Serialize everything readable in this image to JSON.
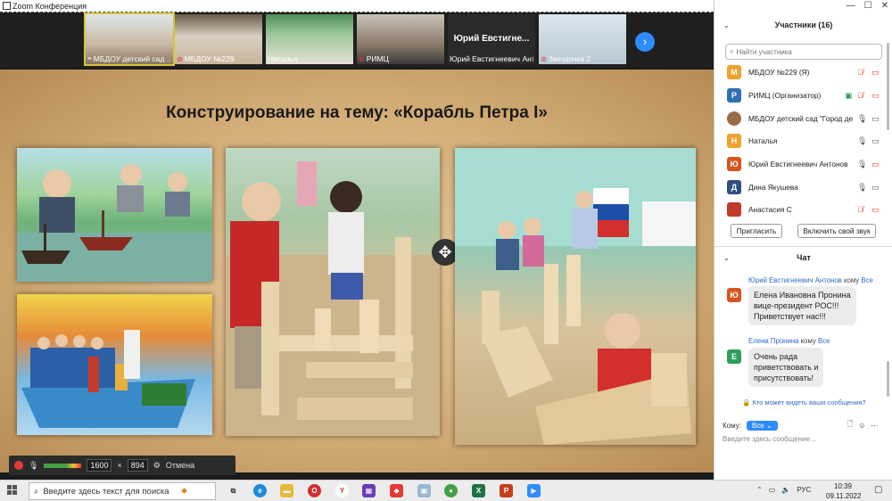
{
  "window": {
    "title": "Zoom Конференция"
  },
  "video_strip": {
    "tiles": [
      {
        "caption": "МБДОУ детский сад ...",
        "muted": false,
        "active": true
      },
      {
        "caption": "МБДОУ №229",
        "muted": true
      },
      {
        "caption": "Наталья",
        "muted": false
      },
      {
        "caption": "РИМЦ",
        "muted": true
      },
      {
        "caption": "Юрий Евстигнеевич Ант...",
        "muted": false,
        "big_name": "Юрий Евстигне..."
      },
      {
        "caption": "Звездочка 2",
        "muted": true
      }
    ]
  },
  "slide": {
    "title": "Конструирование на тему: «Корабль Петра I»"
  },
  "recording_toolbar": {
    "width": "1600",
    "sep": "×",
    "height": "894",
    "cancel_label": "Отмена"
  },
  "participants": {
    "header": "Участники (16)",
    "search_placeholder": "Найти участника",
    "list": [
      {
        "initial": "М",
        "color": "#f0a12a",
        "name": "МБДОУ №229 (Я)"
      },
      {
        "initial": "Р",
        "color": "#2f6fb6",
        "name": "РИМЦ (Организатор)"
      },
      {
        "initial": "",
        "color": "#9b6b45",
        "name": "МБДОУ детский сад \"Город де..."
      },
      {
        "initial": "Н",
        "color": "#f0a12a",
        "name": "Наталья"
      },
      {
        "initial": "Ю",
        "color": "#d9531e",
        "name": "Юрий Евстигнеевич Антонов"
      },
      {
        "initial": "Д",
        "color": "#2f4f7f",
        "name": "Дина Якушева"
      },
      {
        "initial": "",
        "color": "#c0392b",
        "name": "Анастасия С"
      }
    ],
    "invite_label": "Пригласить",
    "unmute_label": "Включить свой звук"
  },
  "chat": {
    "header": "Чат",
    "messages": [
      {
        "sender": "Юрий Евстигнеевич Антонов",
        "to_word": "кому",
        "to": "Все",
        "initial": "Ю",
        "color": "#d9531e",
        "lines": [
          "Елена Ивановна Пронина",
          "вице-президент РОС!!!",
          "Приветствует нас!!!"
        ]
      },
      {
        "sender": "Елена Пронина",
        "to_word": "кому",
        "to": "Все",
        "initial": "Е",
        "color": "#2e9e5b",
        "lines": [
          "Очень рада",
          "приветствовать и",
          "присутствовать!"
        ]
      }
    ],
    "who_can_see": "Кто может видеть ваши сообщения?",
    "to_label": "Кому:",
    "to_value": "Все",
    "input_placeholder": "Введите здесь сообщение..."
  },
  "taskbar": {
    "search_placeholder": "Введите здесь текст для поиска",
    "lang": "РУС",
    "time": "10:39",
    "date": "09.11.2022"
  }
}
